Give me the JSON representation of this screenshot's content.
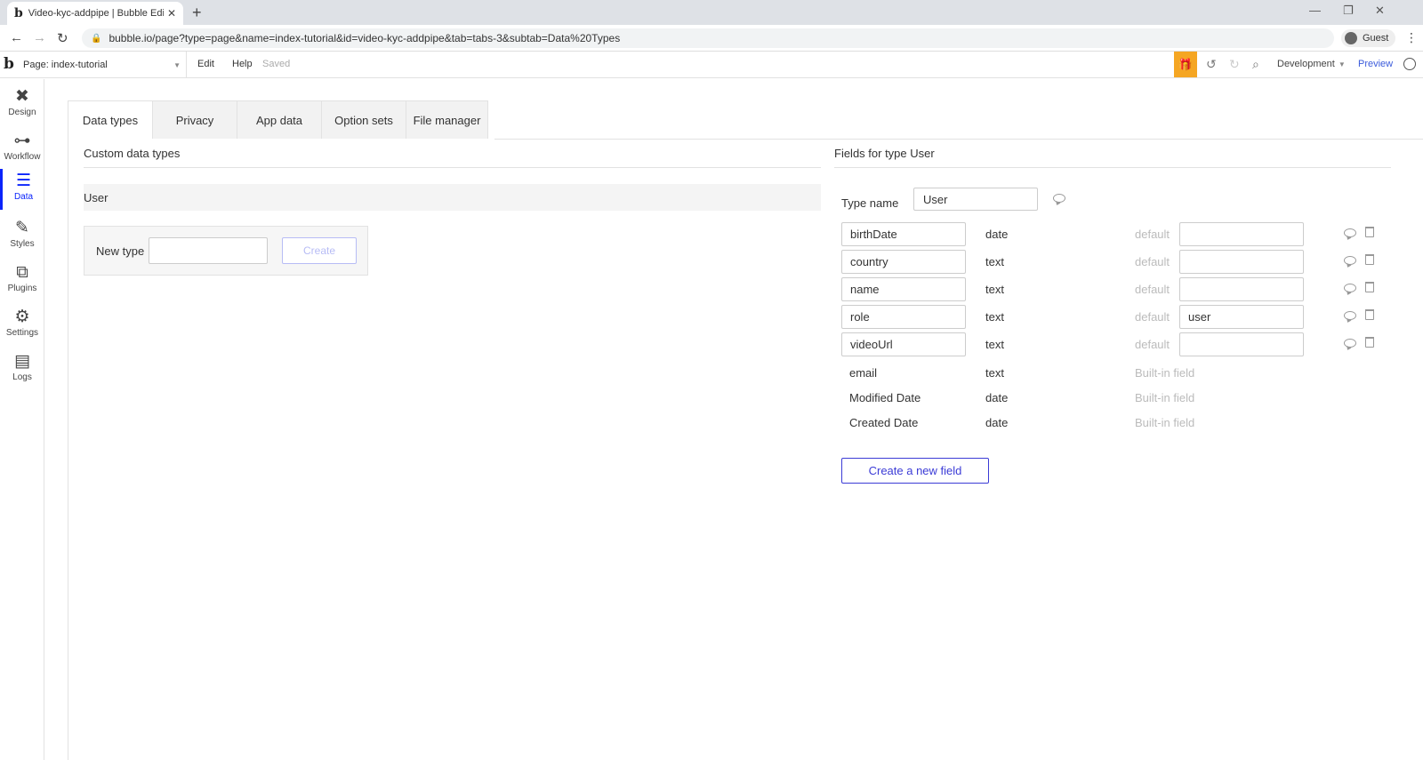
{
  "browser": {
    "tab_title": "Video-kyc-addpipe | Bubble Edit",
    "favicon": "b",
    "new_tab": "+",
    "url": "bubble.io/page?type=page&name=index-tutorial&id=video-kyc-addpipe&tab=tabs-3&subtab=Data%20Types",
    "profile": "Guest"
  },
  "topbar": {
    "logo": "b",
    "page_selector": "Page: index-tutorial",
    "edit": "Edit",
    "help": "Help",
    "status": "Saved",
    "environment": "Development",
    "preview": "Preview"
  },
  "sidebar": {
    "items": [
      {
        "label": "Design",
        "icon": "design-icon"
      },
      {
        "label": "Workflow",
        "icon": "workflow-icon"
      },
      {
        "label": "Data",
        "icon": "database-icon"
      },
      {
        "label": "Styles",
        "icon": "brush-icon"
      },
      {
        "label": "Plugins",
        "icon": "plug-icon"
      },
      {
        "label": "Settings",
        "icon": "gear-icon"
      },
      {
        "label": "Logs",
        "icon": "document-icon"
      }
    ],
    "active": "Data"
  },
  "data_tabs": [
    "Data types",
    "Privacy",
    "App data",
    "Option sets",
    "File manager"
  ],
  "left_panel": {
    "title": "Custom data types",
    "types": [
      "User"
    ],
    "new_type_label": "New type",
    "new_type_value": "",
    "create_button": "Create"
  },
  "right_panel": {
    "title": "Fields for type User",
    "type_name_label": "Type name",
    "type_name_value": "User",
    "default_label": "default",
    "fields": [
      {
        "name": "birthDate",
        "type": "date",
        "default": ""
      },
      {
        "name": "country",
        "type": "text",
        "default": ""
      },
      {
        "name": "name",
        "type": "text",
        "default": ""
      },
      {
        "name": "role",
        "type": "text",
        "default": "user"
      },
      {
        "name": "videoUrl",
        "type": "text",
        "default": ""
      }
    ],
    "builtin_fields": [
      {
        "name": "email",
        "type": "text",
        "note": "Built-in field"
      },
      {
        "name": "Modified Date",
        "type": "date",
        "note": "Built-in field"
      },
      {
        "name": "Created Date",
        "type": "date",
        "note": "Built-in field"
      }
    ],
    "create_field_button": "Create a new field"
  },
  "colors": {
    "accent": "#0b24fb",
    "button_border": "#3b3bd6",
    "gift": "#f5a623"
  }
}
